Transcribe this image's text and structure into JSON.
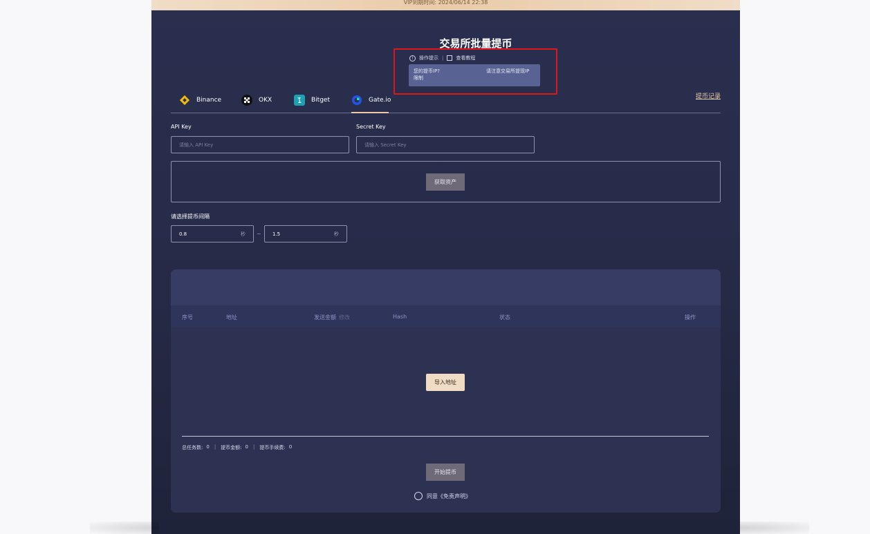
{
  "vip_notice": "VIP到期时间: 2024/06/14 22:38",
  "page_title": "交易所批量提币",
  "hints": {
    "operation_tip": "操作提示",
    "tutorial": "查看教程",
    "tooltip_left_line1": "您的提币IP?",
    "tooltip_left_line2": "限制",
    "tooltip_right": "请注意交易所提现IP"
  },
  "exchanges": {
    "binance": "Binance",
    "okx": "OKX",
    "bitget": "Bitget",
    "gateio": "Gate.io"
  },
  "records_link": "提币记录",
  "api": {
    "api_key_label": "API Key",
    "api_key_placeholder": "请输入 API Key",
    "secret_key_label": "Secret Key",
    "secret_key_placeholder": "请输入 Secret Key"
  },
  "get_assets_button": "获取资产",
  "interval": {
    "label": "请选择提币间隔",
    "min_value": "0.8",
    "max_value": "1.5",
    "unit": "秒",
    "separator": "~"
  },
  "table": {
    "headers": {
      "index": "序号",
      "address": "地址",
      "amount": "发送金额",
      "amount_edit": "修改",
      "hash": "Hash",
      "status": "状态",
      "action": "操作"
    },
    "import_button": "导入地址"
  },
  "summary": {
    "total_tasks_label": "总任务数:",
    "total_tasks": "0",
    "amount_label": "提币金额:",
    "amount": "0",
    "fee_label": "提币手续费:",
    "fee": "0"
  },
  "start_button": "开始提币",
  "agree_text": "同意《免责声明》",
  "colors": {
    "panel_bg": "#2a2f4f",
    "accent_gold": "#e9cba8",
    "highlight_red": "#e2151b",
    "header_text": "#8b92c8"
  }
}
